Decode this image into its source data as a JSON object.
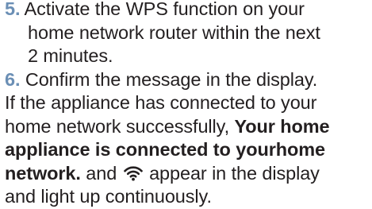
{
  "step5": {
    "number": "5.",
    "line1": "Activate the WPS function on your",
    "line2": "home network router within the next",
    "line3": "2 minutes."
  },
  "step6": {
    "number": "6.",
    "line1": "Confirm the message in the display.",
    "line2": "If the appliance has connected to your",
    "line3_plain": "home network successfully,",
    "line3_bold": "Your home",
    "line4_bold": "appliance is connected to yourhome",
    "line5_bold": "network.",
    "line5_plain_a": "and",
    "line5_plain_b": "appear in the display",
    "line6": "and light up continuously."
  },
  "icons": {
    "wifi": "wifi-icon"
  },
  "colors": {
    "step_number": "#6b8fb5",
    "text": "#231f20"
  }
}
